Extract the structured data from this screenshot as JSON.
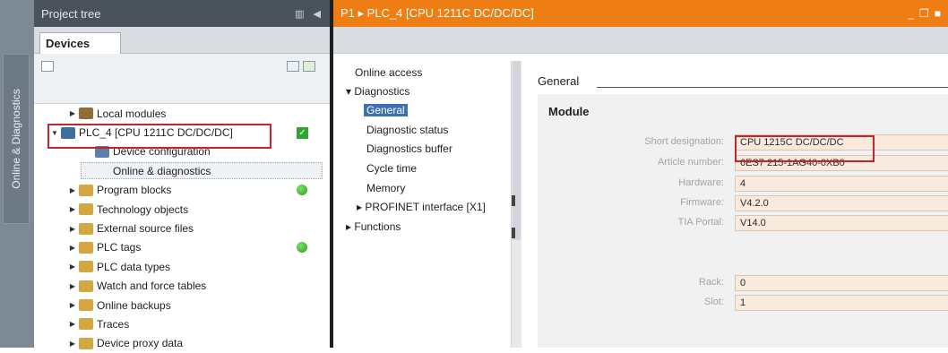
{
  "side_strip": {
    "label": "Online & Diagnostics"
  },
  "tree": {
    "header": "Project tree",
    "tab": "Devices",
    "items": [
      {
        "label": "Local modules",
        "indent": 1,
        "expander": "▶",
        "color": "#8f6c38"
      },
      {
        "label": "PLC_4 [CPU 1211C DC/DC/DC]",
        "indent": 0,
        "expander": "▼",
        "color": "#3f6f9e"
      },
      {
        "label": "Device configuration",
        "indent": 2,
        "expander": "",
        "color": "#5d7fa8"
      },
      {
        "label": "Online & diagnostics",
        "indent": 2,
        "expander": "",
        "color": "#6b8fb8"
      },
      {
        "label": "Program blocks",
        "indent": 1,
        "expander": "▶",
        "color": "#d4a742"
      },
      {
        "label": "Technology objects",
        "indent": 1,
        "expander": "▶",
        "color": "#d4a742"
      },
      {
        "label": "External source files",
        "indent": 1,
        "expander": "▶",
        "color": "#d4a742"
      },
      {
        "label": "PLC tags",
        "indent": 1,
        "expander": "▶",
        "color": "#d4a742"
      },
      {
        "label": "PLC data types",
        "indent": 1,
        "expander": "▶",
        "color": "#d4a742"
      },
      {
        "label": "Watch and force tables",
        "indent": 1,
        "expander": "▶",
        "color": "#d4a742"
      },
      {
        "label": "Online backups",
        "indent": 1,
        "expander": "▶",
        "color": "#d4a742"
      },
      {
        "label": "Traces",
        "indent": 1,
        "expander": "▶",
        "color": "#d4a742"
      },
      {
        "label": "Device proxy data",
        "indent": 1,
        "expander": "▶",
        "color": "#d4a742"
      }
    ]
  },
  "editor": {
    "breadcrumb": "P1 ▸ PLC_4 [CPU 1211C DC/DC/DC]",
    "window_controls": [
      "_",
      "❐",
      "■"
    ],
    "nav": [
      {
        "label": "Online access"
      },
      {
        "label": "▾ Diagnostics"
      },
      {
        "label": "General"
      },
      {
        "label": "Diagnostic status"
      },
      {
        "label": "Diagnostics buffer"
      },
      {
        "label": "Cycle time"
      },
      {
        "label": "Memory"
      },
      {
        "label": "▸ PROFINET interface [X1]"
      },
      {
        "label": "▸ Functions"
      }
    ],
    "section_title": "General",
    "module_title": "Module",
    "fields": [
      {
        "label": "Short designation:",
        "value": "CPU 1215C DC/DC/DC"
      },
      {
        "label": "Article number:",
        "value": "6ES7 215-1AG40-0XB0"
      },
      {
        "label": "Hardware:",
        "value": "4"
      },
      {
        "label": "Firmware:",
        "value": "V4.2.0"
      },
      {
        "label": "TIA Portal:",
        "value": "V14.0"
      },
      {
        "label": "Rack:",
        "value": "0"
      },
      {
        "label": "Slot:",
        "value": "1"
      }
    ]
  },
  "colors": {
    "editor_header": "#ee7d13",
    "tree_header": "#4a525b",
    "selection": "#3d6fb3",
    "highlight_box": "#c0272d"
  }
}
